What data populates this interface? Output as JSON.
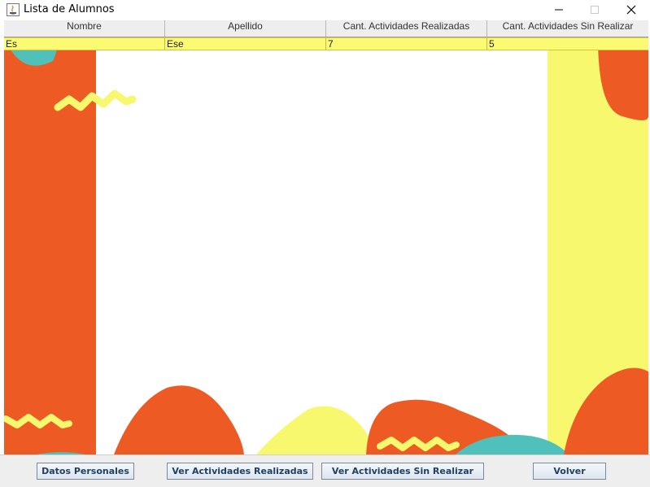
{
  "window": {
    "title": "Lista de Alumnos"
  },
  "table": {
    "columns": [
      "Nombre",
      "Apellido",
      "Cant. Actividades Realizadas",
      "Cant. Actividades Sin Realizar"
    ],
    "rows": [
      [
        "Es",
        "Ese",
        "7",
        "5"
      ]
    ]
  },
  "buttons": {
    "datos_personales": "Datos Personales",
    "ver_realizadas": "Ver Actividades Realizadas",
    "ver_sin_realizar": "Ver Actividades Sin Realizar",
    "volver": "Volver"
  },
  "colors": {
    "orange": "#ee5a24",
    "yellow": "#f8f86e",
    "teal": "#4fc1ba",
    "selected_row": "#fafa73"
  }
}
